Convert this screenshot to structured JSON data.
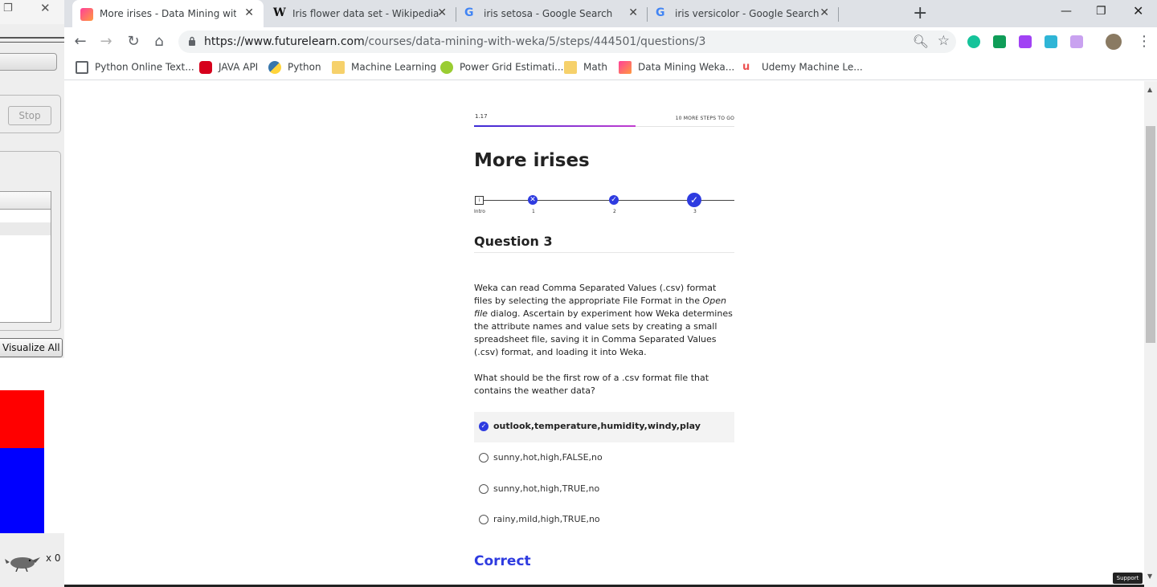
{
  "weka": {
    "stop_label": "Stop",
    "visualize_label": "Visualize All",
    "count_label": "x 0"
  },
  "browser": {
    "tabs": [
      {
        "title": "More irises - Data Mining with W",
        "icon": "futurelearn-icon",
        "active": true
      },
      {
        "title": "Iris flower data set - Wikipedia",
        "icon": "wikipedia-icon",
        "active": false
      },
      {
        "title": "iris setosa - Google Search",
        "icon": "google-icon",
        "active": false
      },
      {
        "title": "iris versicolor - Google Search",
        "icon": "google-icon",
        "active": false
      }
    ],
    "url_host": "https://www.futurelearn.com",
    "url_path": "/courses/data-mining-with-weka/5/steps/444501/questions/3",
    "bookmarks": [
      {
        "label": "Python Online Text...",
        "color": "#5f6368"
      },
      {
        "label": "JAVA API",
        "color": "#d6001c"
      },
      {
        "label": "Python",
        "color": "#3776ab"
      },
      {
        "label": "Machine Learning",
        "color": "#f6d16b"
      },
      {
        "label": "Power Grid Estimati...",
        "color": "#9acd32"
      },
      {
        "label": "Math",
        "color": "#f6d16b"
      },
      {
        "label": "Data Mining Weka...",
        "color": "#e040a0"
      },
      {
        "label": "Udemy Machine Le...",
        "color": "#ec5252"
      }
    ]
  },
  "page": {
    "step_number": "1.17",
    "steps_to_go": "10 MORE STEPS TO GO",
    "progress_fraction": 0.62,
    "title": "More irises",
    "stepper": {
      "intro_label": "Intro",
      "intro_box": "i",
      "steps": [
        "1",
        "2",
        "3"
      ]
    },
    "question_title": "Question 3",
    "para1_a": "Weka can read Comma Separated Values (.csv) format files by selecting the appropriate File Format in the ",
    "para1_em": "Open file",
    "para1_b": " dialog. Ascertain by experiment how Weka determines the attribute names and value sets by creating a small spreadsheet file, saving it in Comma Separated Values (.csv) format, and loading it into Weka.",
    "para2": "What should be the first row of a .csv format file that contains the weather data?",
    "options": [
      "outlook,temperature,humidity,windy,play",
      "sunny,hot,high,FALSE,no",
      "sunny,hot,high,TRUE,no",
      "rainy,mild,high,TRUE,no"
    ],
    "selected_index": 0,
    "result": "Correct",
    "support_label": "Support"
  }
}
